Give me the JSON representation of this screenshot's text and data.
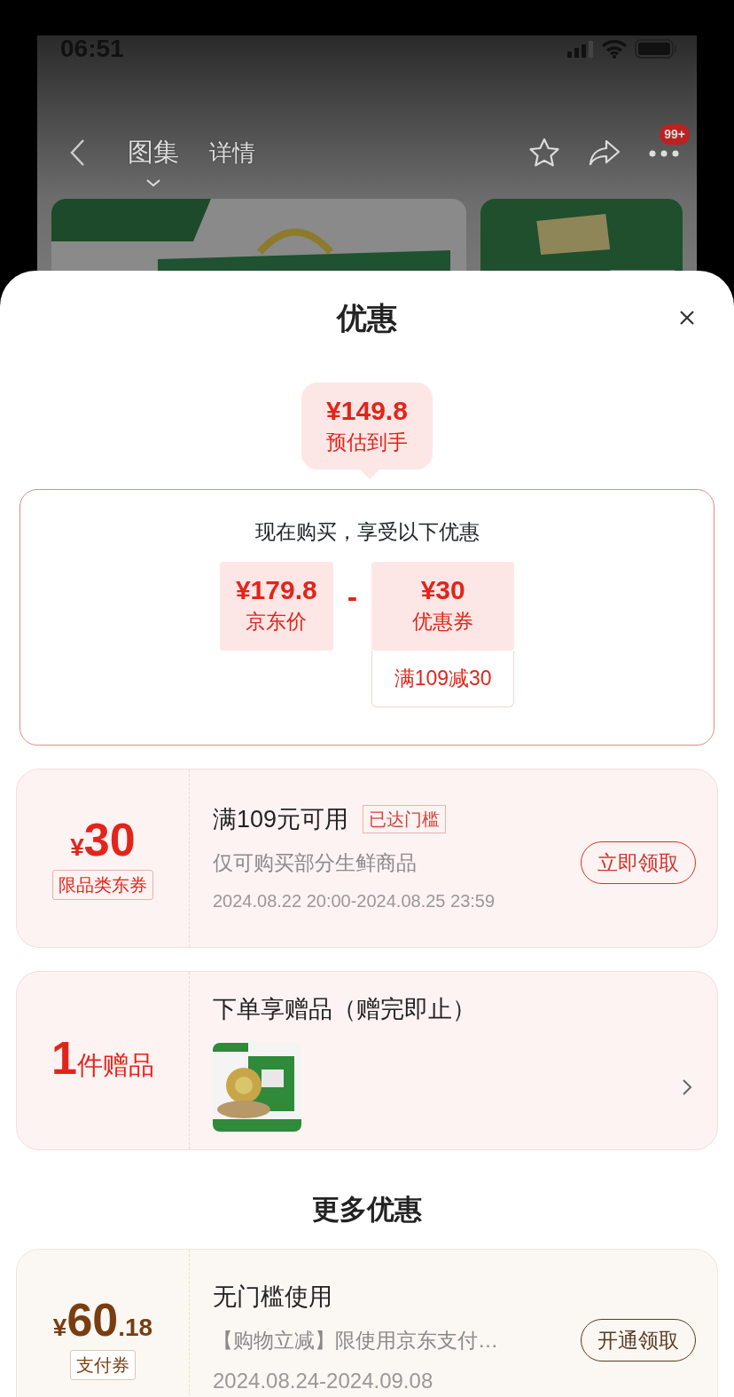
{
  "status_bar": {
    "time": "06:51"
  },
  "nav": {
    "tabs": [
      {
        "label": "图集",
        "selected": true
      },
      {
        "label": "详情",
        "selected": false
      }
    ],
    "badge": "99+"
  },
  "sheet": {
    "title": "优惠",
    "estimate": {
      "price": "¥149.8",
      "label": "预估到手"
    },
    "breakdown": {
      "heading": "现在购买，享受以下优惠",
      "operator": "-",
      "items": [
        {
          "amount": "¥179.8",
          "label": "京东价"
        },
        {
          "amount": "¥30",
          "label": "优惠券",
          "note": "满109减30"
        }
      ]
    },
    "coupons": [
      {
        "kind": "store",
        "currency": "¥",
        "amount": "30",
        "label": "限品类东券",
        "title": "满109元可用",
        "badge": "已达门槛",
        "desc": "仅可购买部分生鲜商品",
        "period": "2024.08.22 20:00-2024.08.25 23:59",
        "button": "立即领取"
      }
    ],
    "gift": {
      "count": "1",
      "unit": "件赠品",
      "title": "下单享赠品（赠完即止）"
    },
    "more_title": "更多优惠",
    "more_coupons": [
      {
        "kind": "payment",
        "currency": "¥",
        "amount": "60",
        "decimal": ".18",
        "label": "支付券",
        "title": "无门槛使用",
        "desc": "【购物立减】限使用京东支付…",
        "period": "2024.08.24-2024.09.08",
        "button": "开通领取"
      }
    ]
  }
}
